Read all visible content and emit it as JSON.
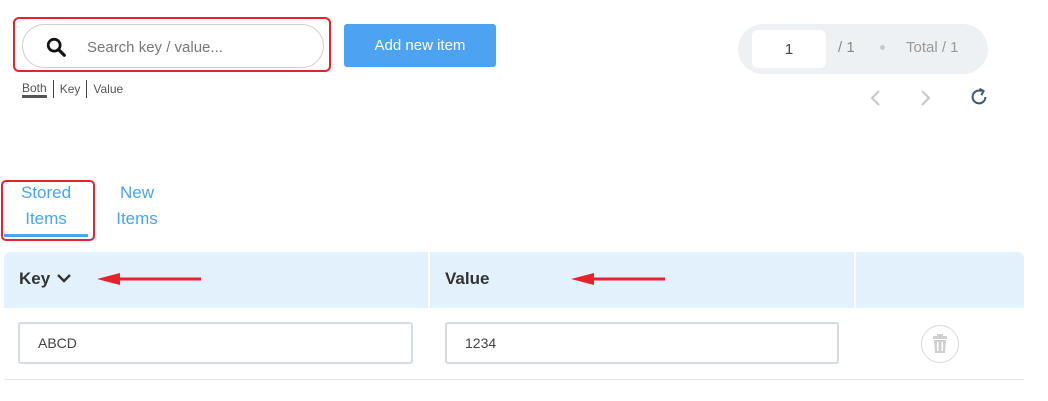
{
  "search": {
    "placeholder": "Search key / value...",
    "filters": [
      "Both",
      "Key",
      "Value"
    ],
    "active_filter": "Both"
  },
  "toolbar": {
    "add_label": "Add new item"
  },
  "pagination": {
    "current_page": "1",
    "of_label": "/ 1",
    "total_label": "Total / 1"
  },
  "tabs": [
    {
      "label": "Stored Items",
      "active": true
    },
    {
      "label": "New Items",
      "active": false
    }
  ],
  "table": {
    "columns": [
      "Key",
      "Value"
    ],
    "rows": [
      {
        "key": "ABCD",
        "value": "1234"
      }
    ]
  },
  "colors": {
    "accent": "#4ba3f2",
    "highlight": "#e5232a",
    "header_bg": "#e3f1fc"
  },
  "icons": [
    "search-icon",
    "chevron-left-icon",
    "chevron-right-icon",
    "refresh-icon",
    "chevron-down-icon",
    "trash-icon",
    "arrow-left-icon"
  ]
}
